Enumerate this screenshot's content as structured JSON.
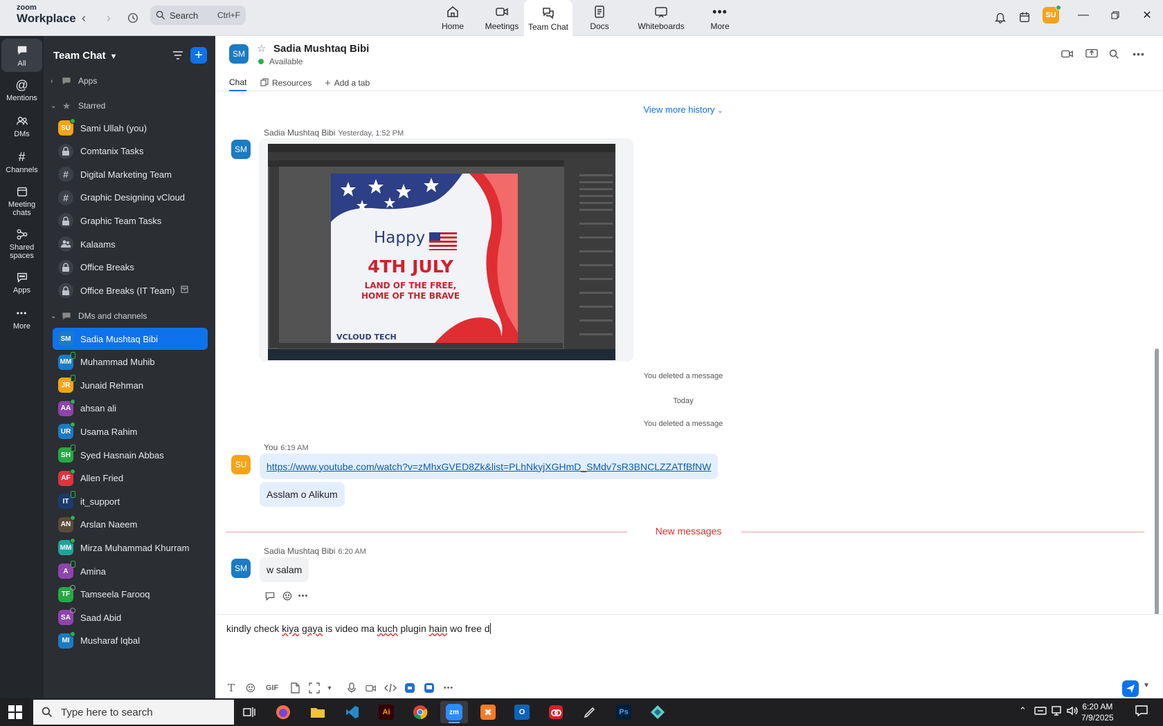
{
  "app": {
    "logo_line1": "zoom",
    "logo_line2": "Workplace"
  },
  "top_search": {
    "label": "Search",
    "shortcut": "Ctrl+F"
  },
  "top_tabs": [
    {
      "label": "Home",
      "icon": "home-icon"
    },
    {
      "label": "Meetings",
      "icon": "video-icon"
    },
    {
      "label": "Team Chat",
      "icon": "chat-icon",
      "active": true
    },
    {
      "label": "Docs",
      "icon": "docs-icon"
    },
    {
      "label": "Whiteboards",
      "icon": "whiteboard-icon"
    },
    {
      "label": "More",
      "icon": "more-icon"
    }
  ],
  "user_avatar": "SU",
  "rail": [
    {
      "label": "All",
      "active": true
    },
    {
      "label": "Mentions"
    },
    {
      "label": "DMs"
    },
    {
      "label": "Channels"
    },
    {
      "label": "Meeting chats"
    },
    {
      "label": "Shared spaces"
    },
    {
      "label": "Apps"
    },
    {
      "label": "More"
    }
  ],
  "sidebar": {
    "title": "Team Chat",
    "sections": {
      "apps": "Apps",
      "starred": "Starred",
      "dms": "DMs and channels"
    },
    "starred": [
      {
        "initials": "SU",
        "color": "#f5a417",
        "label": "Sami Ullah (you)"
      },
      {
        "label": "Comtanix Tasks",
        "icon": "lock"
      },
      {
        "label": "Digital Marketing Team",
        "icon": "hash"
      },
      {
        "label": "Graphic Designing vCloud",
        "icon": "hash"
      },
      {
        "label": "Graphic Team Tasks",
        "icon": "lock"
      },
      {
        "label": "Kalaams",
        "icon": "people"
      },
      {
        "label": "Office Breaks",
        "icon": "lock"
      },
      {
        "label": "Office Breaks (IT Team)",
        "icon": "lock"
      }
    ],
    "dms": [
      {
        "initials": "SM",
        "color": "#1b7bc4",
        "label": "Sadia Mushtaq Bibi",
        "active": true
      },
      {
        "initials": "MM",
        "color": "#1b7bc4",
        "label": "Muhammad Muhib"
      },
      {
        "initials": "JR",
        "color": "#f5a417",
        "label": "Junaid Rehman"
      },
      {
        "initials": "AA",
        "color": "#8e44ad",
        "label": "ahsan ali"
      },
      {
        "initials": "UR",
        "color": "#1b7bc4",
        "label": "Usama Rahim"
      },
      {
        "initials": "SH",
        "color": "#27a844",
        "label": "Syed Hasnain Abbas"
      },
      {
        "initials": "AF",
        "color": "#d9363e",
        "label": "Allen Fried"
      },
      {
        "initials": "IT",
        "color": "#1d3a6e",
        "label": "it_support"
      },
      {
        "initials": "AN",
        "color": "#5b4a3a",
        "label": "Arslan Naeem"
      },
      {
        "initials": "MM",
        "color": "#20a39e",
        "label": "Mirza Muhammad Khurram"
      },
      {
        "initials": "A",
        "color": "#8e44ad",
        "label": "Amina"
      },
      {
        "initials": "TF",
        "color": "#27a844",
        "label": "Tamseela Farooq"
      },
      {
        "initials": "SA",
        "color": "#8e44ad",
        "label": "Saad Abid"
      },
      {
        "initials": "MI",
        "color": "#1b7bc4",
        "label": "Musharaf Iqbal"
      }
    ]
  },
  "chat": {
    "contact_initials": "SM",
    "contact_name": "Sadia Mushtaq Bibi",
    "contact_status": "Available",
    "tabs": {
      "chat": "Chat",
      "resources": "Resources",
      "add": "Add a tab"
    },
    "view_more": "View more history",
    "msg1": {
      "sender": "Sadia Mushtaq Bibi",
      "time": "Yesterday, 1:52 PM"
    },
    "poster": {
      "happy": "Happy",
      "title": "4TH JULY",
      "line1": "LAND OF THE FREE,",
      "line2": "HOME OF THE BRAVE",
      "brand": "VCLOUD TECH"
    },
    "deleted1": "You deleted a message",
    "today": "Today",
    "deleted2": "You deleted a message",
    "msg2": {
      "sender": "You",
      "time": "6:19 AM",
      "initials": "SU",
      "link": "https://www.youtube.com/watch?v=zMhxGVED8Zk&list=PLhNkyjXGHmD_SMdv7sR3BNCLZZATfBfNW",
      "text": "Asslam o Alikum"
    },
    "new_messages": "New messages",
    "msg3": {
      "sender": "Sadia Mushtaq Bibi",
      "time": "6:20 AM",
      "initials": "SM",
      "text": "w salam"
    }
  },
  "composer": {
    "w1": "kindly check ",
    "w2": "kiya",
    "w3": " ",
    "w4": "gaya",
    "w5": " is video ma ",
    "w6": "kuch",
    "w7": " plugin ",
    "w8": "hain",
    "w9": " wo free d",
    "gif": "GIF"
  },
  "taskbar": {
    "search_placeholder": "Type here to search",
    "time": "6:20 AM",
    "date": "7/9/2025"
  }
}
